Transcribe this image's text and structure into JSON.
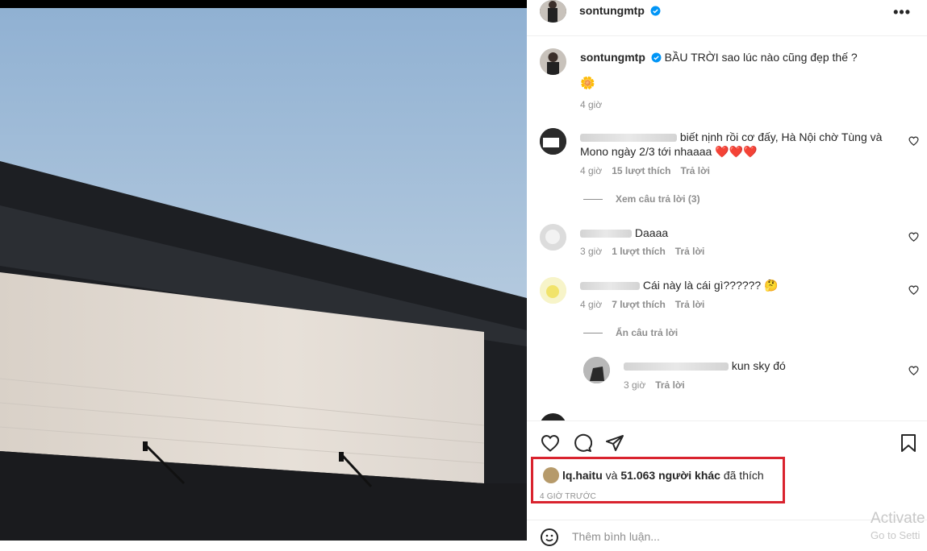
{
  "post": {
    "author": "sontungmtp",
    "caption": "BẦU TRỜI sao lúc nào cũng đẹp thế ?",
    "caption_emoji": "🌼",
    "caption_time": "4 giờ"
  },
  "comments": [
    {
      "text": "biết nịnh rồi cơ đấy, Hà Nội chờ Tùng và Mono ngày 2/3 tới nhaaaa",
      "trailing_hearts": "❤️❤️❤️",
      "time": "4 giờ",
      "likes": "15 lượt thích",
      "reply": "Trả lời",
      "thread": "Xem câu trả lời (3)"
    },
    {
      "text": "Daaaa",
      "time": "3 giờ",
      "likes": "1 lượt thích",
      "reply": "Trả lời"
    },
    {
      "text": "Cái này là cái gì??????",
      "trailing_emoji": "🤔",
      "time": "4 giờ",
      "likes": "7 lượt thích",
      "reply": "Trả lời",
      "thread": "Ẩn câu trả lời"
    }
  ],
  "reply": {
    "text": "kun sky đó",
    "time": "3 giờ",
    "reply": "Trả lời"
  },
  "likes_line": {
    "user": "lq.haitu",
    "connector": "và",
    "others": "51.063 người khác",
    "suffix": "đã thích"
  },
  "timestamp": "4 GIỜ TRƯỚC",
  "add_comment_placeholder": "Thêm bình luận...",
  "watermark": {
    "line1": "Activate",
    "line2": "Go to Setti"
  },
  "colors": {
    "highlight_box": "#d9232e",
    "verified": "#0095f6"
  }
}
